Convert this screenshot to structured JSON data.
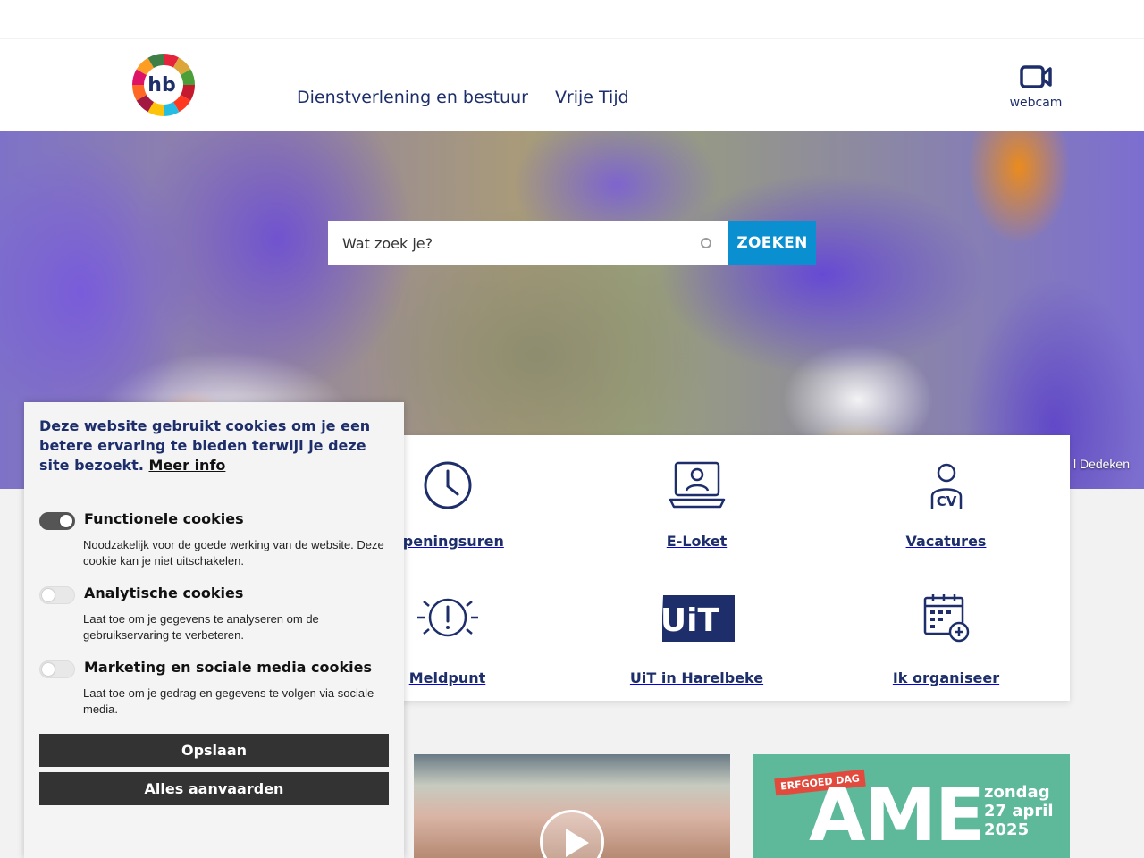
{
  "header": {
    "logo_alt": "hb",
    "nav": [
      {
        "label": "Dienstverlening en bestuur"
      },
      {
        "label": "Vrije Tijd"
      }
    ],
    "webcam_label": "webcam"
  },
  "hero": {
    "search_placeholder": "Wat zoek je?",
    "search_button": "ZOEKEN",
    "photo_credit": "l Dedeken"
  },
  "quicklinks": [
    {
      "label": "Openingsuren",
      "icon": "clock-icon"
    },
    {
      "label": "E-Loket",
      "icon": "laptop-user-icon"
    },
    {
      "label": "Vacatures",
      "icon": "person-cv-icon"
    },
    {
      "label": "Meldpunt",
      "icon": "alert-icon"
    },
    {
      "label": "UiT in Harelbeke",
      "icon": "uit-logo-icon"
    },
    {
      "label": "Ik organiseer",
      "icon": "calendar-plus-icon"
    }
  ],
  "cards": {
    "card2_badge": "ERFGOED DAG",
    "card2_title": "AME",
    "card2_date_line1": "zondag",
    "card2_date_line2": "27 april",
    "card2_date_line3": "2025"
  },
  "cookie": {
    "intro": "Deze website gebruikt cookies om je een betere ervaring te bieden terwijl je deze site bezoekt.",
    "more_info": "Meer info",
    "options": [
      {
        "title": "Functionele cookies",
        "desc": "Noodzakelijk voor de goede werking van de website. Deze cookie kan je niet uitschakelen.",
        "enabled": true
      },
      {
        "title": "Analytische cookies",
        "desc": "Laat toe om je gegevens te analyseren om de gebruikservaring te verbeteren.",
        "enabled": false
      },
      {
        "title": "Marketing en sociale media cookies",
        "desc": "Laat toe om je gedrag en gegevens te volgen via sociale media.",
        "enabled": false
      }
    ],
    "save_button": "Opslaan",
    "accept_all_button": "Alles aanvaarden"
  },
  "colors": {
    "brand_navy": "#1d2e6b",
    "search_button": "#0a8fd1",
    "cookie_button": "#333333"
  }
}
